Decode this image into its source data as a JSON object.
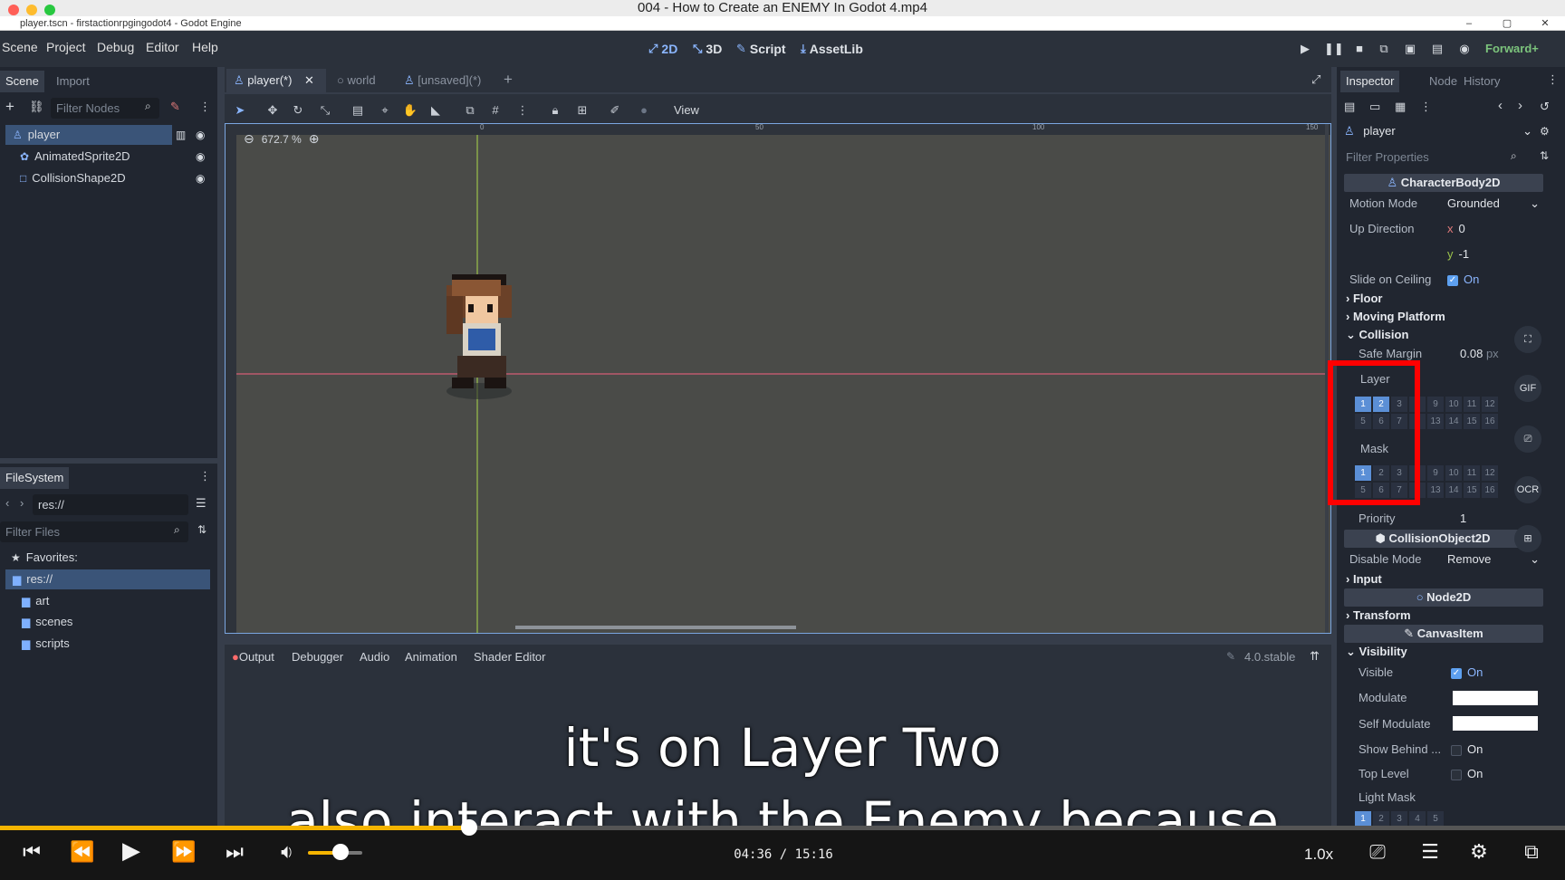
{
  "video": {
    "title": "004 - How to Create an ENEMY In Godot 4.mp4",
    "subtitle_line1": "it's on Layer Two",
    "subtitle_line2": "also interact with the Enemy because",
    "time_current": "04:36",
    "time_separator": "/",
    "time_total": "15:16",
    "speed": "1.0x",
    "progress": 0.3,
    "volume": 0.6
  },
  "editor": {
    "window_title": "player.tscn - firstactionrpgingodot4 - Godot Engine",
    "menu": [
      "Scene",
      "Project",
      "Debug",
      "Editor",
      "Help"
    ],
    "workspaces": [
      {
        "icon": "2d-icon",
        "glyph": "⤢",
        "label": "2D",
        "active": true
      },
      {
        "icon": "3d-icon",
        "glyph": "⤡",
        "label": "3D",
        "active": false
      },
      {
        "icon": "script-icon",
        "glyph": "✎",
        "label": "Script",
        "active": false
      },
      {
        "icon": "assetlib-icon",
        "glyph": "⤓",
        "label": "AssetLib",
        "active": false
      }
    ],
    "renderer": "Forward+"
  },
  "scene_dock": {
    "tabs": [
      "Scene",
      "Import"
    ],
    "filter_placeholder": "Filter Nodes",
    "nodes": [
      {
        "label": "player",
        "icon": "characterbody-icon",
        "selected": true
      },
      {
        "label": "AnimatedSprite2D",
        "icon": "animatedsprite-icon",
        "selected": false
      },
      {
        "label": "CollisionShape2D",
        "icon": "collisionshape-icon",
        "selected": false
      }
    ]
  },
  "filesystem_dock": {
    "title": "FileSystem",
    "path": "res://",
    "filter_placeholder": "Filter Files",
    "favorites_label": "Favorites:",
    "root": "res://",
    "folders": [
      "art",
      "scenes",
      "scripts"
    ]
  },
  "scene_tabs": [
    "player(*)",
    "world",
    "[unsaved](*)"
  ],
  "viewport": {
    "view_menu": "View",
    "zoom": "672.7 %",
    "ruler_labels": [
      "0",
      "50",
      "100",
      "150"
    ]
  },
  "bottom_panel": {
    "tabs": [
      "Output",
      "Debugger",
      "Audio",
      "Animation",
      "Shader Editor"
    ],
    "version": "4.0.stable"
  },
  "inspector": {
    "tabs": [
      "Inspector",
      "Node",
      "History"
    ],
    "object": "player",
    "filter_placeholder": "Filter Properties",
    "class_characterbody": "CharacterBody2D",
    "motion_mode_label": "Motion Mode",
    "motion_mode_value": "Grounded",
    "up_direction_label": "Up Direction",
    "up_x_axis": "x",
    "up_x": "0",
    "up_y_axis": "y",
    "up_y": "-1",
    "slide_label": "Slide on Ceiling",
    "slide_value": "On",
    "floor": "Floor",
    "moving_platform": "Moving Platform",
    "collision": "Collision",
    "safe_margin_label": "Safe Margin",
    "safe_margin_value": "0.08",
    "safe_margin_unit": "px",
    "layer_label": "Layer",
    "mask_label": "Mask",
    "layer_row1": [
      "1",
      "2",
      "3",
      "4",
      "9",
      "10",
      "11",
      "12"
    ],
    "layer_row2": [
      "5",
      "6",
      "7",
      "8",
      "13",
      "14",
      "15",
      "16"
    ],
    "priority_label": "Priority",
    "priority_value": "1",
    "class_collisionobject": "CollisionObject2D",
    "disable_mode_label": "Disable Mode",
    "disable_mode_value": "Remove",
    "input": "Input",
    "class_node2d": "Node2D",
    "transform": "Transform",
    "class_canvasitem": "CanvasItem",
    "visibility": "Visibility",
    "visible_label": "Visible",
    "visible_value": "On",
    "modulate_label": "Modulate",
    "self_modulate_label": "Self Modulate",
    "show_behind_label": "Show Behind ...",
    "show_behind_value": "On",
    "top_level_label": "Top Level",
    "top_level_value": "On",
    "light_mask_label": "Light Mask",
    "light_mask_cells": [
      "1",
      "2",
      "3",
      "4",
      "5"
    ]
  },
  "side_tools": [
    "GIF",
    "OCR"
  ],
  "colors": {
    "accent": "#5da0f0",
    "progress": "#f4b400",
    "highlight": "#ff0000"
  }
}
